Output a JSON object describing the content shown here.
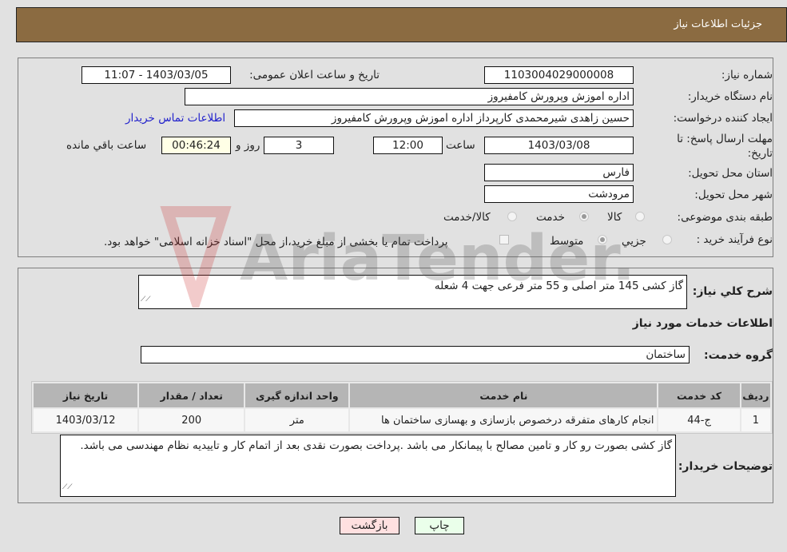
{
  "header": {
    "title": "جزئیات اطلاعات نیاز"
  },
  "form": {
    "need_number_label": "شماره نیاز:",
    "need_number": "1103004029000008",
    "announce_label": "تاریخ و ساعت اعلان عمومی:",
    "announce_value": "1403/03/05 - 11:07",
    "buyer_org_label": "نام دستگاه خریدار:",
    "buyer_org": "اداره اموزش وپرورش کامفیروز",
    "creator_label": "ایجاد کننده درخواست:",
    "creator": "حسین زاهدی شیرمحمدی کارپرداز اداره اموزش وپرورش کامفیروز",
    "contact_link": "اطلاعات تماس خریدار",
    "deadline_label_line1": "مهلت ارسال پاسخ: تا",
    "deadline_label_line2": "تاریخ:",
    "deadline_date": "1403/03/08",
    "hour_label": "ساعت",
    "deadline_time": "12:00",
    "days_value": "3",
    "days_label": "روز و",
    "remaining_time": "00:46:24",
    "remaining_label": "ساعت باقي مانده",
    "province_label": "استان محل تحویل:",
    "province": "فارس",
    "city_label": "شهر محل تحویل:",
    "city": "مرودشت",
    "category_label": "طبقه بندی موضوعی:",
    "category_options": [
      {
        "label": "کالا",
        "selected": false
      },
      {
        "label": "خدمت",
        "selected": true
      },
      {
        "label": "کالا/خدمت",
        "selected": false
      }
    ],
    "process_label": "نوع فرآیند خرید :",
    "process_options": [
      {
        "label": "جزيي",
        "selected": false
      },
      {
        "label": "متوسط",
        "selected": true
      }
    ],
    "treasury_note": "پرداخت تمام یا بخشی از مبلغ خرید،از محل \"اسناد خزانه اسلامی\" خواهد بود.",
    "treasury_checked": false
  },
  "details": {
    "summary_label": "شرح كلي نياز:",
    "summary_text": "گاز کشی 145 متر اصلی و 55 متر فرعی جهت 4 شعله",
    "services_heading": "اطلاعات خدمات مورد نیاز",
    "service_group_label": "گروه خدمت:",
    "service_group": "ساختمان",
    "table": {
      "headers": [
        "ردیف",
        "کد خدمت",
        "نام خدمت",
        "واحد اندازه گیری",
        "تعداد / مقدار",
        "تاریخ نیاز"
      ],
      "rows": [
        [
          "1",
          "ج-44",
          "انجام کارهای متفرقه درخصوص بازسازی و بهسازی ساختمان ها",
          "متر",
          "200",
          "1403/03/12"
        ]
      ]
    },
    "buyer_notes_label": "توضیحات خریدار:",
    "buyer_notes": "گاز کشی بصورت رو کار و تامین مصالح با پیمانکار می باشد .پرداخت بصورت نقدی بعد از اتمام کار و تاییدیه نظام مهندسی می باشد."
  },
  "buttons": {
    "print": "چاپ",
    "back": "بازگشت"
  },
  "colors": {
    "header": "#8b6b41",
    "print_bg": "#eaffea",
    "back_bg": "#ffe0e0",
    "link": "#2222cc"
  },
  "watermark": {
    "text": "AriaTender.neT"
  }
}
